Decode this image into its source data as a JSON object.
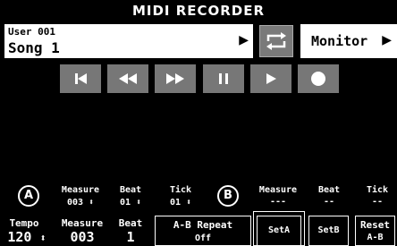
{
  "header": {
    "title": "MIDI RECORDER"
  },
  "song": {
    "user": "User 001",
    "name": "Song 1",
    "arrow": "▶"
  },
  "loop": {
    "icon": "loop-icon"
  },
  "monitor": {
    "label": "Monitor",
    "arrow": "▶"
  },
  "transport": [
    {
      "name": "skip-to-start-button",
      "icon": "skip-start-icon"
    },
    {
      "name": "rewind-button",
      "icon": "rewind-icon"
    },
    {
      "name": "fast-forward-button",
      "icon": "fast-forward-icon"
    },
    {
      "name": "pause-button",
      "icon": "pause-icon"
    },
    {
      "name": "play-button",
      "icon": "play-icon"
    },
    {
      "name": "record-button",
      "icon": "record-icon"
    }
  ],
  "point_a": {
    "label": "A",
    "measure_label": "Measure",
    "measure_value": "003",
    "beat_label": "Beat",
    "beat_value": "01",
    "tick_label": "Tick",
    "tick_value": "01"
  },
  "point_b": {
    "label": "B",
    "measure_label": "Measure",
    "measure_value": "---",
    "beat_label": "Beat",
    "beat_value": "--",
    "tick_label": "Tick",
    "tick_value": "--"
  },
  "bottom": {
    "tempo_label": "Tempo",
    "tempo_value": "120",
    "measure_label": "Measure",
    "measure_value": "003",
    "beat_label": "Beat",
    "beat_value": "1",
    "ab_repeat_label": "A-B Repeat",
    "ab_repeat_value": "Off",
    "seta_label": "SetA",
    "setb_label": "SetB",
    "reset_label": "Reset",
    "reset_sub": "A-B"
  },
  "glyphs": {
    "updown": "⬍"
  }
}
